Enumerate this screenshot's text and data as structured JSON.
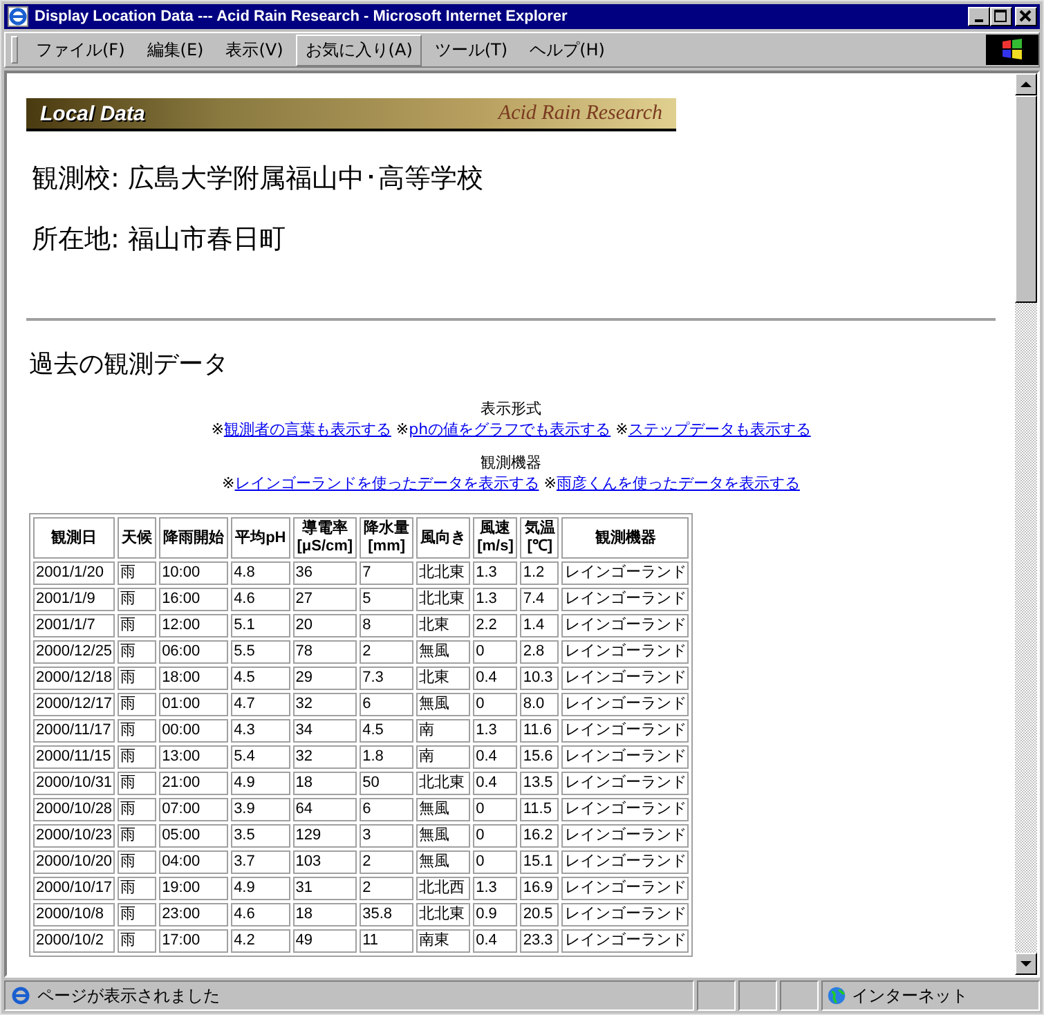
{
  "window": {
    "title": "Display Location Data --- Acid Rain Research - Microsoft Internet Explorer"
  },
  "menu": [
    {
      "label": "ファイル(F)",
      "selected": false
    },
    {
      "label": "編集(E)",
      "selected": false
    },
    {
      "label": "表示(V)",
      "selected": false
    },
    {
      "label": "お気に入り(A)",
      "selected": true
    },
    {
      "label": "ツール(T)",
      "selected": false
    },
    {
      "label": "ヘルプ(H)",
      "selected": false
    }
  ],
  "banner": {
    "title": "Local Data",
    "subtitle": "Acid Rain Research"
  },
  "school": "観測校: 広島大学附属福山中･高等学校",
  "location": "所在地: 福山市春日町",
  "section_title": "過去の観測データ",
  "display_options": {
    "heading": "表示形式",
    "links": [
      {
        "prefix": "※",
        "label": "観測者の言葉も表示する"
      },
      {
        "prefix": "※",
        "label": "phの値をグラフでも表示する"
      },
      {
        "prefix": "※",
        "label": "ステップデータも表示する"
      }
    ]
  },
  "instrument_options": {
    "heading": "観測機器",
    "links": [
      {
        "prefix": "※",
        "label": "レインゴーランドを使ったデータを表示する"
      },
      {
        "prefix": "※",
        "label": "雨彦くんを使ったデータを表示する"
      }
    ]
  },
  "table": {
    "columns": [
      {
        "label": "観測日"
      },
      {
        "label": "天候"
      },
      {
        "label": "降雨開始"
      },
      {
        "label": "平均pH"
      },
      {
        "label": "導電率",
        "unit": "[μS/cm]"
      },
      {
        "label": "降水量",
        "unit": "[mm]"
      },
      {
        "label": "風向き"
      },
      {
        "label": "風速",
        "unit": "[m/s]"
      },
      {
        "label": "気温",
        "unit": "[℃]"
      },
      {
        "label": "観測機器"
      }
    ],
    "rows": [
      [
        "2001/1/20",
        "雨",
        "10:00",
        "4.8",
        "36",
        "7",
        "北北東",
        "1.3",
        "1.2",
        "レインゴーランド"
      ],
      [
        "2001/1/9",
        "雨",
        "16:00",
        "4.6",
        "27",
        "5",
        "北北東",
        "1.3",
        "7.4",
        "レインゴーランド"
      ],
      [
        "2001/1/7",
        "雨",
        "12:00",
        "5.1",
        "20",
        "8",
        "北東",
        "2.2",
        "1.4",
        "レインゴーランド"
      ],
      [
        "2000/12/25",
        "雨",
        "06:00",
        "5.5",
        "78",
        "2",
        "無風",
        "0",
        "2.8",
        "レインゴーランド"
      ],
      [
        "2000/12/18",
        "雨",
        "18:00",
        "4.5",
        "29",
        "7.3",
        "北東",
        "0.4",
        "10.3",
        "レインゴーランド"
      ],
      [
        "2000/12/17",
        "雨",
        "01:00",
        "4.7",
        "32",
        "6",
        "無風",
        "0",
        "8.0",
        "レインゴーランド"
      ],
      [
        "2000/11/17",
        "雨",
        "00:00",
        "4.3",
        "34",
        "4.5",
        "南",
        "1.3",
        "11.6",
        "レインゴーランド"
      ],
      [
        "2000/11/15",
        "雨",
        "13:00",
        "5.4",
        "32",
        "1.8",
        "南",
        "0.4",
        "15.6",
        "レインゴーランド"
      ],
      [
        "2000/10/31",
        "雨",
        "21:00",
        "4.9",
        "18",
        "50",
        "北北東",
        "0.4",
        "13.5",
        "レインゴーランド"
      ],
      [
        "2000/10/28",
        "雨",
        "07:00",
        "3.9",
        "64",
        "6",
        "無風",
        "0",
        "11.5",
        "レインゴーランド"
      ],
      [
        "2000/10/23",
        "雨",
        "05:00",
        "3.5",
        "129",
        "3",
        "無風",
        "0",
        "16.2",
        "レインゴーランド"
      ],
      [
        "2000/10/20",
        "雨",
        "04:00",
        "3.7",
        "103",
        "2",
        "無風",
        "0",
        "15.1",
        "レインゴーランド"
      ],
      [
        "2000/10/17",
        "雨",
        "19:00",
        "4.9",
        "31",
        "2",
        "北北西",
        "1.3",
        "16.9",
        "レインゴーランド"
      ],
      [
        "2000/10/8",
        "雨",
        "23:00",
        "4.6",
        "18",
        "35.8",
        "北北東",
        "0.9",
        "20.5",
        "レインゴーランド"
      ],
      [
        "2000/10/2",
        "雨",
        "17:00",
        "4.2",
        "49",
        "11",
        "南東",
        "0.4",
        "23.3",
        "レインゴーランド"
      ]
    ]
  },
  "status_bar": {
    "message": "ページが表示されました",
    "zone": "インターネット"
  }
}
